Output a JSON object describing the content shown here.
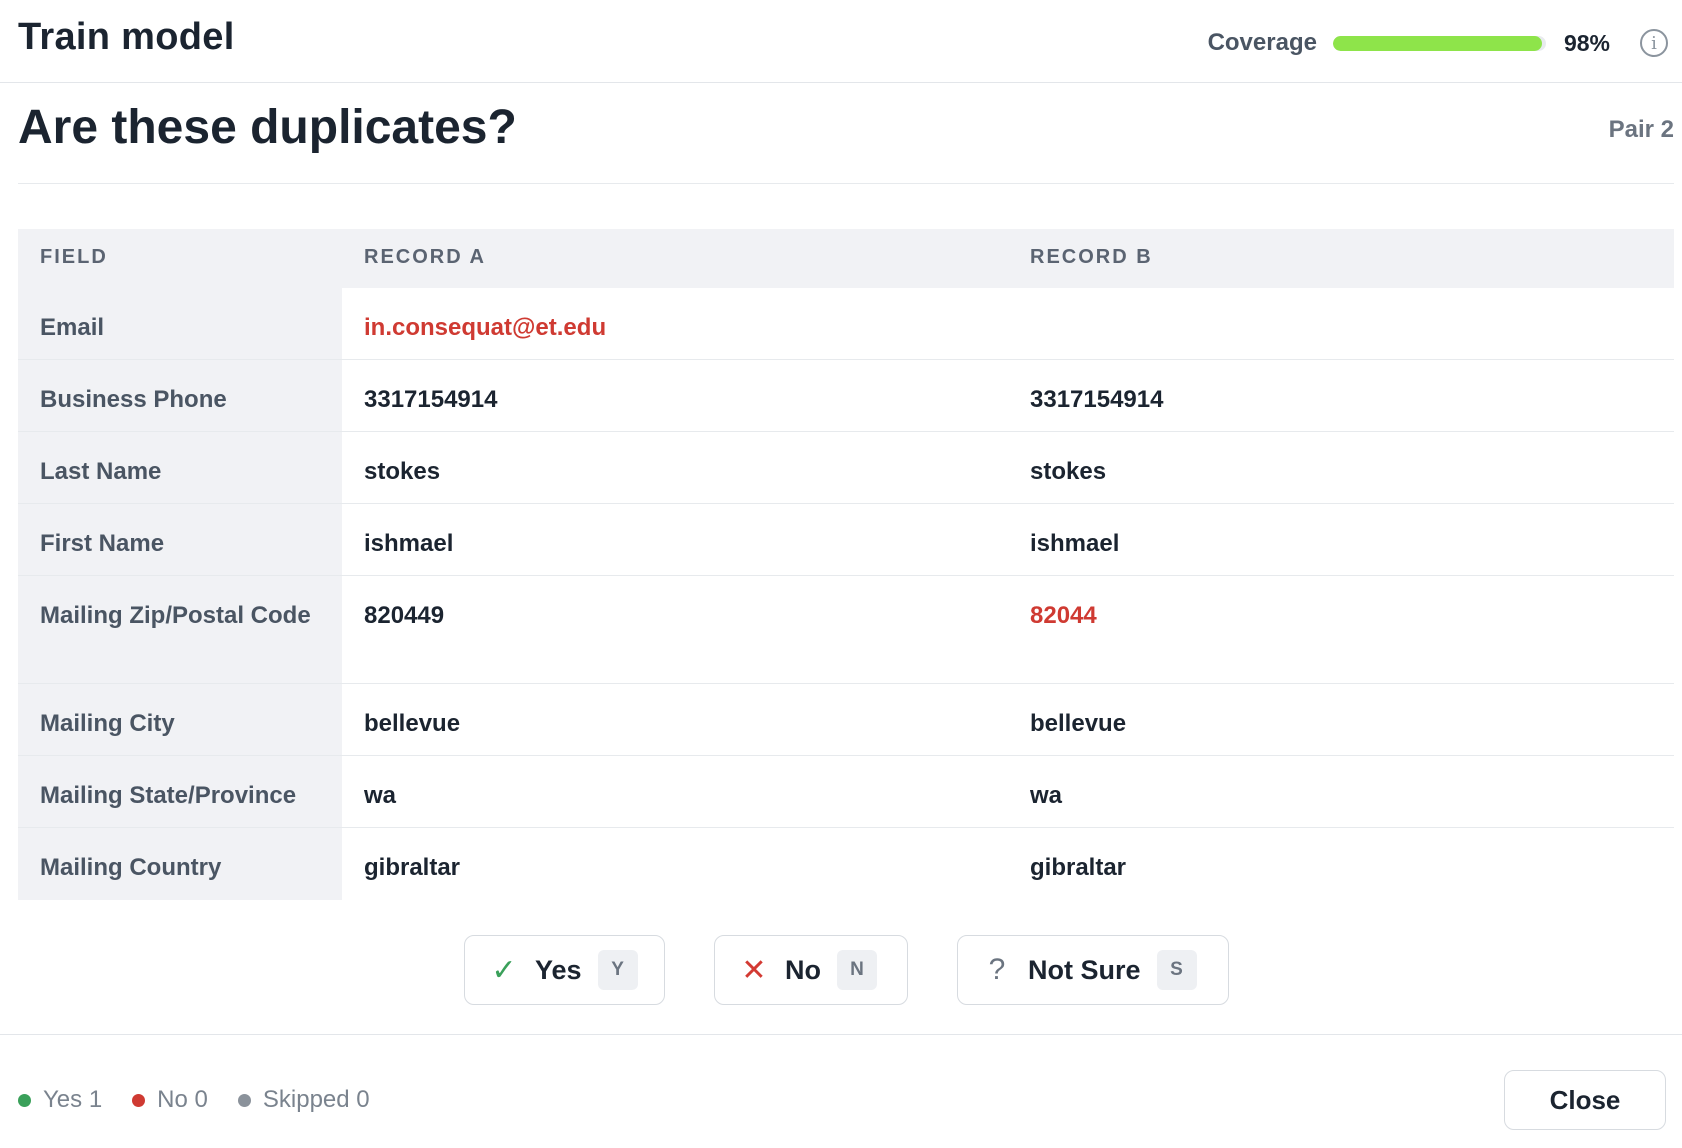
{
  "header": {
    "title": "Train model",
    "coverage_label": "Coverage",
    "coverage_value": "98%",
    "coverage_fraction": 0.98
  },
  "question": {
    "title": "Are these duplicates?",
    "pair_label": "Pair 2"
  },
  "table": {
    "columns": [
      "FIELD",
      "RECORD A",
      "RECORD B"
    ],
    "rows": [
      {
        "field": "Email",
        "a": "in.consequat@et.edu",
        "b": ""
      },
      {
        "field": "Business Phone",
        "a": "3317154914",
        "b": "3317154914"
      },
      {
        "field": "Last Name",
        "a": "stokes",
        "b": "stokes"
      },
      {
        "field": "First Name",
        "a": "ishmael",
        "b": "ishmael"
      },
      {
        "field": "Mailing Zip/Postal Code",
        "a": "820449",
        "b": "82044"
      },
      {
        "field": "Mailing City",
        "a": "bellevue",
        "b": "bellevue"
      },
      {
        "field": "Mailing State/Province",
        "a": "wa",
        "b": "wa"
      },
      {
        "field": "Mailing Country",
        "a": "gibraltar",
        "b": "gibraltar"
      }
    ]
  },
  "actions": {
    "yes_label": "Yes",
    "yes_key": "Y",
    "no_label": "No",
    "no_key": "N",
    "notsure_label": "Not Sure",
    "notsure_key": "S"
  },
  "stats": {
    "yes": "Yes 1",
    "no": "No 0",
    "skipped": "Skipped 0"
  },
  "footer": {
    "close_label": "Close"
  },
  "colors": {
    "accent_green": "#8ee44a",
    "diff_red": "#cf3a32",
    "yes_green": "#3aa05a"
  }
}
